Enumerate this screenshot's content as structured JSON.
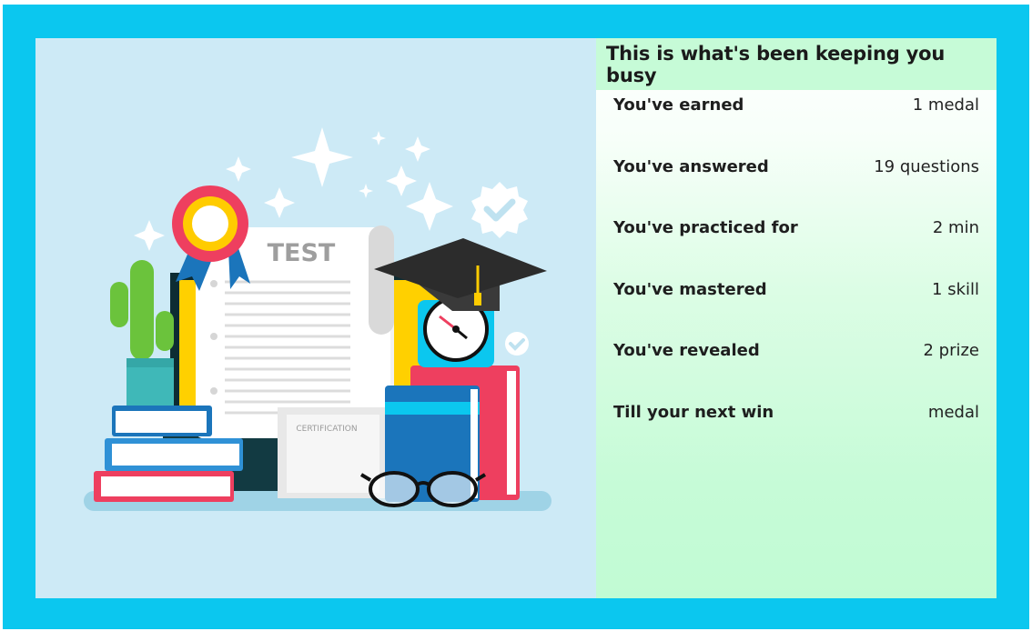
{
  "panel": {
    "title": "This is what's been keeping you busy",
    "stats": [
      {
        "label": "You've earned",
        "value": "1 medal"
      },
      {
        "label": "You've answered",
        "value": "19 questions"
      },
      {
        "label": "You've practiced for",
        "value": "2 min"
      },
      {
        "label": "You've mastered",
        "value": "1 skill"
      },
      {
        "label": "You've revealed",
        "value": "2 prize"
      },
      {
        "label": "Till your next win",
        "value": "medal"
      }
    ]
  },
  "illustration": {
    "test_label": "TEST",
    "certificate_label": "CERTIFICATION"
  },
  "colors": {
    "frame": "#0bc7ef",
    "illustration_bg": "#cdeaf6",
    "panel_header": "#c6fbd7",
    "panel_gradient_end": "#c1fbd4"
  }
}
